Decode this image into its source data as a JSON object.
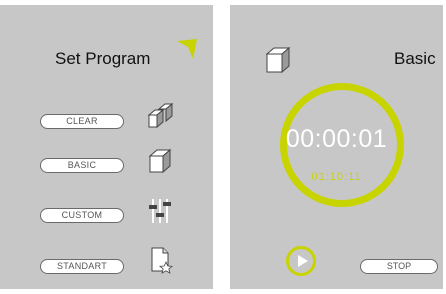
{
  "set_program_screen": {
    "title": "Set Program",
    "buttons": [
      {
        "label": "CLEAR",
        "icon": "cube-pair-icon"
      },
      {
        "label": "BASIC",
        "icon": "cube-icon"
      },
      {
        "label": "CUSTOM",
        "icon": "sliders-icon"
      },
      {
        "label": "STANDART",
        "icon": "document-star-icon"
      }
    ]
  },
  "timer_screen": {
    "title": "Basic",
    "time_main": "00:00:01",
    "time_secondary": "01:10:11",
    "stop_label": "STOP"
  },
  "colors": {
    "panel_background": "#c7c7c7",
    "accent": "#c8d400",
    "button_background": "#ffffff"
  }
}
